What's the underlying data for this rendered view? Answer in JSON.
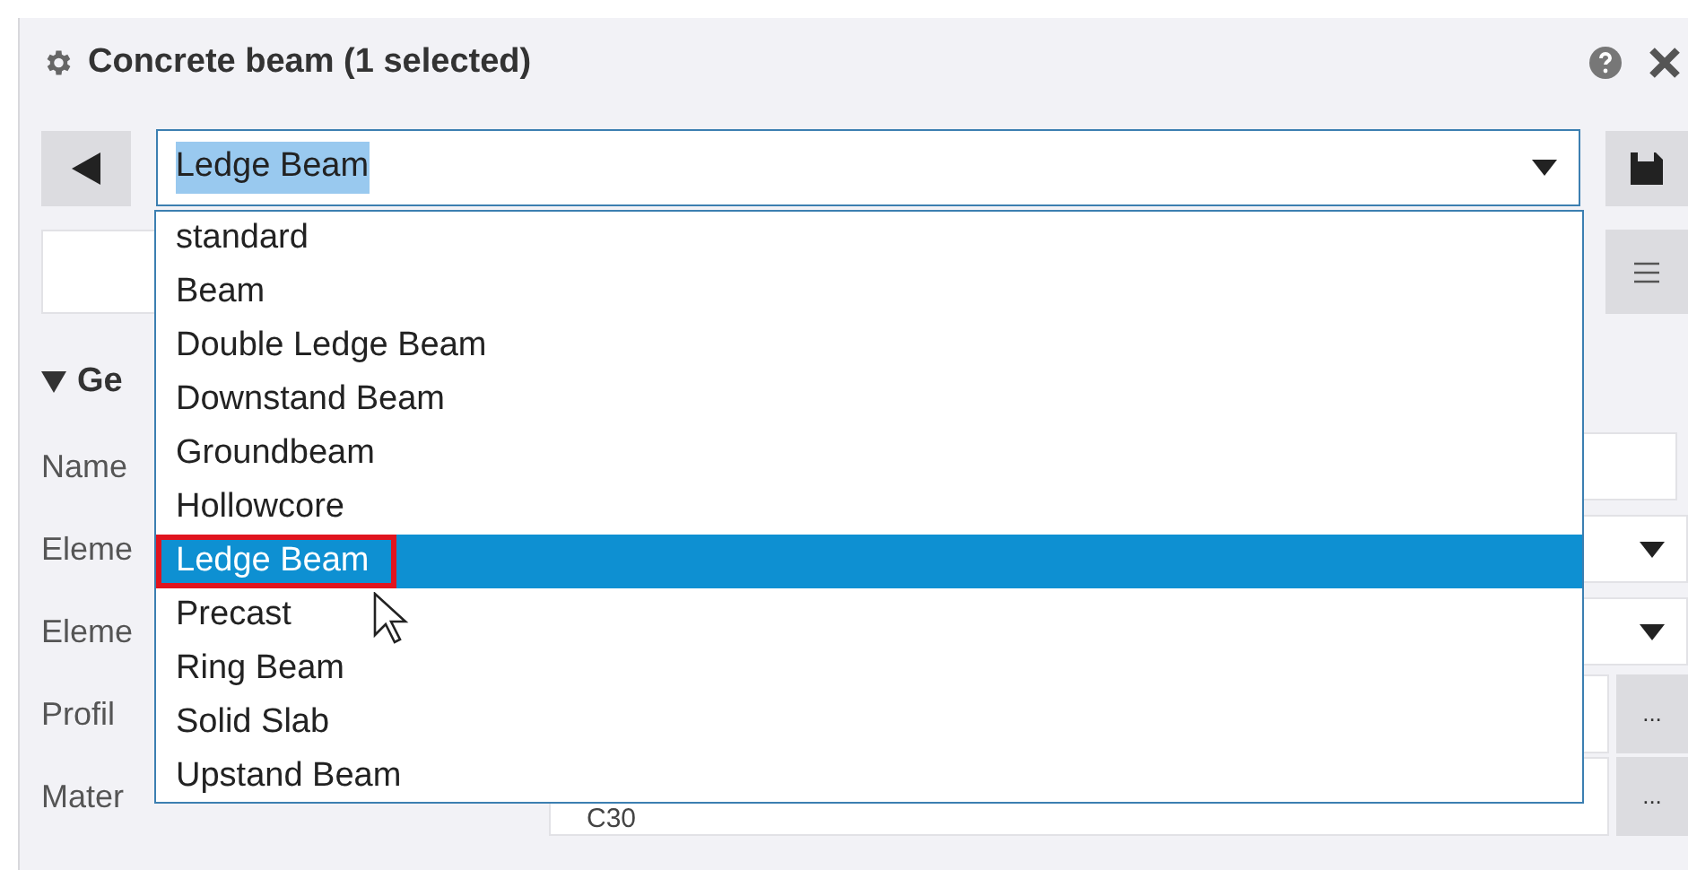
{
  "panel": {
    "title": "Concrete beam (1 selected)"
  },
  "combo": {
    "value": "Ledge Beam",
    "text_selected": true,
    "expanded": true
  },
  "dropdown": {
    "items": [
      {
        "label": "standard",
        "selected": false,
        "outlined": false
      },
      {
        "label": "Beam",
        "selected": false,
        "outlined": false
      },
      {
        "label": "Double Ledge Beam",
        "selected": false,
        "outlined": false
      },
      {
        "label": "Downstand Beam",
        "selected": false,
        "outlined": false
      },
      {
        "label": "Groundbeam",
        "selected": false,
        "outlined": false
      },
      {
        "label": "Hollowcore",
        "selected": false,
        "outlined": false
      },
      {
        "label": "Ledge Beam",
        "selected": true,
        "outlined": true
      },
      {
        "label": "Precast",
        "selected": false,
        "outlined": false
      },
      {
        "label": "Ring Beam",
        "selected": false,
        "outlined": false
      },
      {
        "label": "Solid Slab",
        "selected": false,
        "outlined": false
      },
      {
        "label": "Upstand Beam",
        "selected": false,
        "outlined": false
      }
    ]
  },
  "section": {
    "title": "Ge",
    "expanded": true
  },
  "properties": [
    {
      "label": "Name",
      "kind": "text"
    },
    {
      "label": "Eleme",
      "kind": "select"
    },
    {
      "label": "Eleme",
      "kind": "select"
    },
    {
      "label": "Profil",
      "kind": "browse",
      "button": "..."
    },
    {
      "label": "Mater",
      "kind": "browse",
      "value": "C30",
      "button": "..."
    }
  ]
}
